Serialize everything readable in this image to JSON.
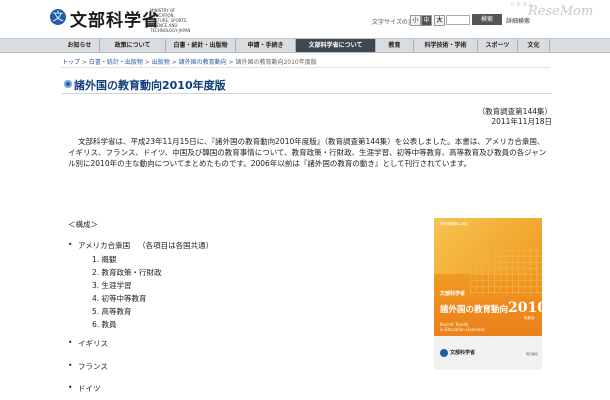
{
  "header": {
    "logo_glyph": "文",
    "title": "文部科学省",
    "title_en_1": "MINISTRY OF EDUCATION,",
    "title_en_2": "CULTURE, SPORTS,",
    "title_en_3": "SCIENCE AND TECHNOLOGY-JAPAN",
    "font_size_label": "文字サイズの変更",
    "font_size_small": "小",
    "font_size_medium": "中",
    "font_size_large": "大",
    "search_placeholder": "",
    "search_button": "検索",
    "detail_search": "詳細検索",
    "watermark_site": "リセマム",
    "watermark": "ReseMom"
  },
  "nav": {
    "items": [
      {
        "label": "お知らせ"
      },
      {
        "label": "政策について"
      },
      {
        "label": "白書・統計・出版物"
      },
      {
        "label": "申請・手続き"
      },
      {
        "label": "文部科学省について"
      },
      {
        "label": "教育"
      },
      {
        "label": "科学技術・学術"
      },
      {
        "label": "スポーツ"
      },
      {
        "label": "文化"
      }
    ]
  },
  "breadcrumb": {
    "items": [
      "トップ",
      "白書・統計・出版物",
      "出版物",
      "諸外国の教育動向",
      "諸外国の教育動向2010年度版"
    ],
    "separator": " > "
  },
  "page": {
    "title": "諸外国の教育動向2010年度版",
    "doc_number": "（教育調査第144集）",
    "date": "2011年11月18日",
    "intro": "文部科学省は、平成23年11月15日に、『諸外国の教育動向2010年度版』（教育調査第144集）を公表しました。本書は、アメリカ合衆国、イギリス、フランス、ドイツ、中国及び韓国の教育事情について、教育政策・行財政、生涯学習、初等中等教育、高等教育及び教員の各ジャンル別に2010年の主な動向についてまとめたものです。2006年以前は『諸外国の教育の動き』として刊行されています。",
    "composition_label": "＜構成＞"
  },
  "structure": {
    "countries": [
      {
        "name": "アメリカ合衆国",
        "note": "（各項目は各国共通）"
      },
      {
        "name": "イギリス"
      },
      {
        "name": "フランス"
      },
      {
        "name": "ドイツ"
      }
    ],
    "sections": [
      "1.  概観",
      "2.  教育政策・行財政",
      "3.  生涯学習",
      "4.  初等中等教育",
      "5.  高等教育",
      "6.  教員"
    ]
  },
  "book": {
    "series": "教育調査第144集",
    "publisher": "文部科学省",
    "title_prefix": "諸外国の教育動向",
    "year": "2010",
    "edition": "年度版",
    "title_en_1": "Recent Trends",
    "title_en_2": "in Education Overseas",
    "ministry": "文部科学省",
    "small_text": "明石書店"
  },
  "colors": {
    "accent": "#0f3d7a",
    "nav_active": "#40484f",
    "book_orange": "#ee8a1c"
  }
}
